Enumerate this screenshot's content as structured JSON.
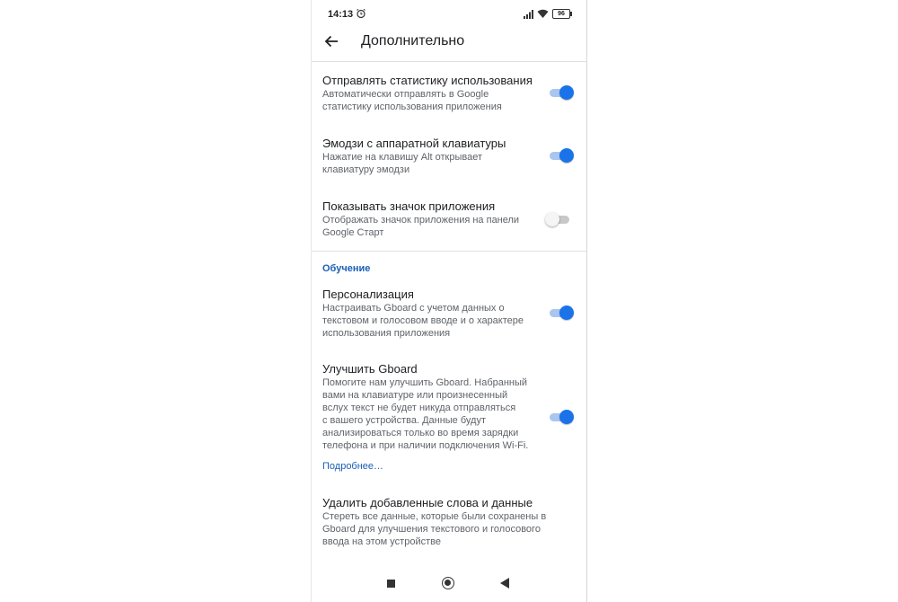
{
  "status_bar": {
    "time": "14:13",
    "battery": "96"
  },
  "app_bar": {
    "title": "Дополнительно"
  },
  "settings": [
    {
      "title": "Отправлять статистику использования",
      "subtitle": [
        "Автоматически отправлять в Google",
        "статистику использования приложения"
      ],
      "enabled": true
    },
    {
      "title": "Эмодзи с аппаратной клавиатуры",
      "subtitle": [
        "Нажатие на клавишу Alt открывает",
        "клавиатуру эмодзи"
      ],
      "enabled": true
    },
    {
      "title": "Показывать значок приложения",
      "subtitle": [
        "Отображать значок приложения на панели",
        "Google Старт"
      ],
      "enabled": false
    }
  ],
  "section_learning": {
    "header": "Обучение",
    "items": [
      {
        "title": "Персонализация",
        "subtitle": [
          "Настраивать Gboard с учетом данных о",
          "текстовом и голосовом вводе и о характере",
          "использования приложения"
        ],
        "enabled": true
      },
      {
        "title": "Улучшить Gboard",
        "subtitle": [
          "Помогите нам улучшить Gboard. Набранный",
          "вами на клавиатуре или произнесенный",
          "вслух текст не будет никуда отправляться",
          "с вашего устройства. Данные будут",
          "анализироваться только во время зарядки",
          "телефона и при наличии подключения Wi-Fi."
        ],
        "enabled": true
      }
    ],
    "link": "Подробнее…",
    "delete_item": {
      "title": "Удалить добавленные слова и данные",
      "subtitle": [
        "Стереть все данные, которые были сохранены в",
        "Gboard для улучшения текстового и голосового",
        "ввода на этом устройстве"
      ]
    }
  },
  "colors": {
    "accent": "#1a73e8",
    "link": "#1a5fb4"
  }
}
